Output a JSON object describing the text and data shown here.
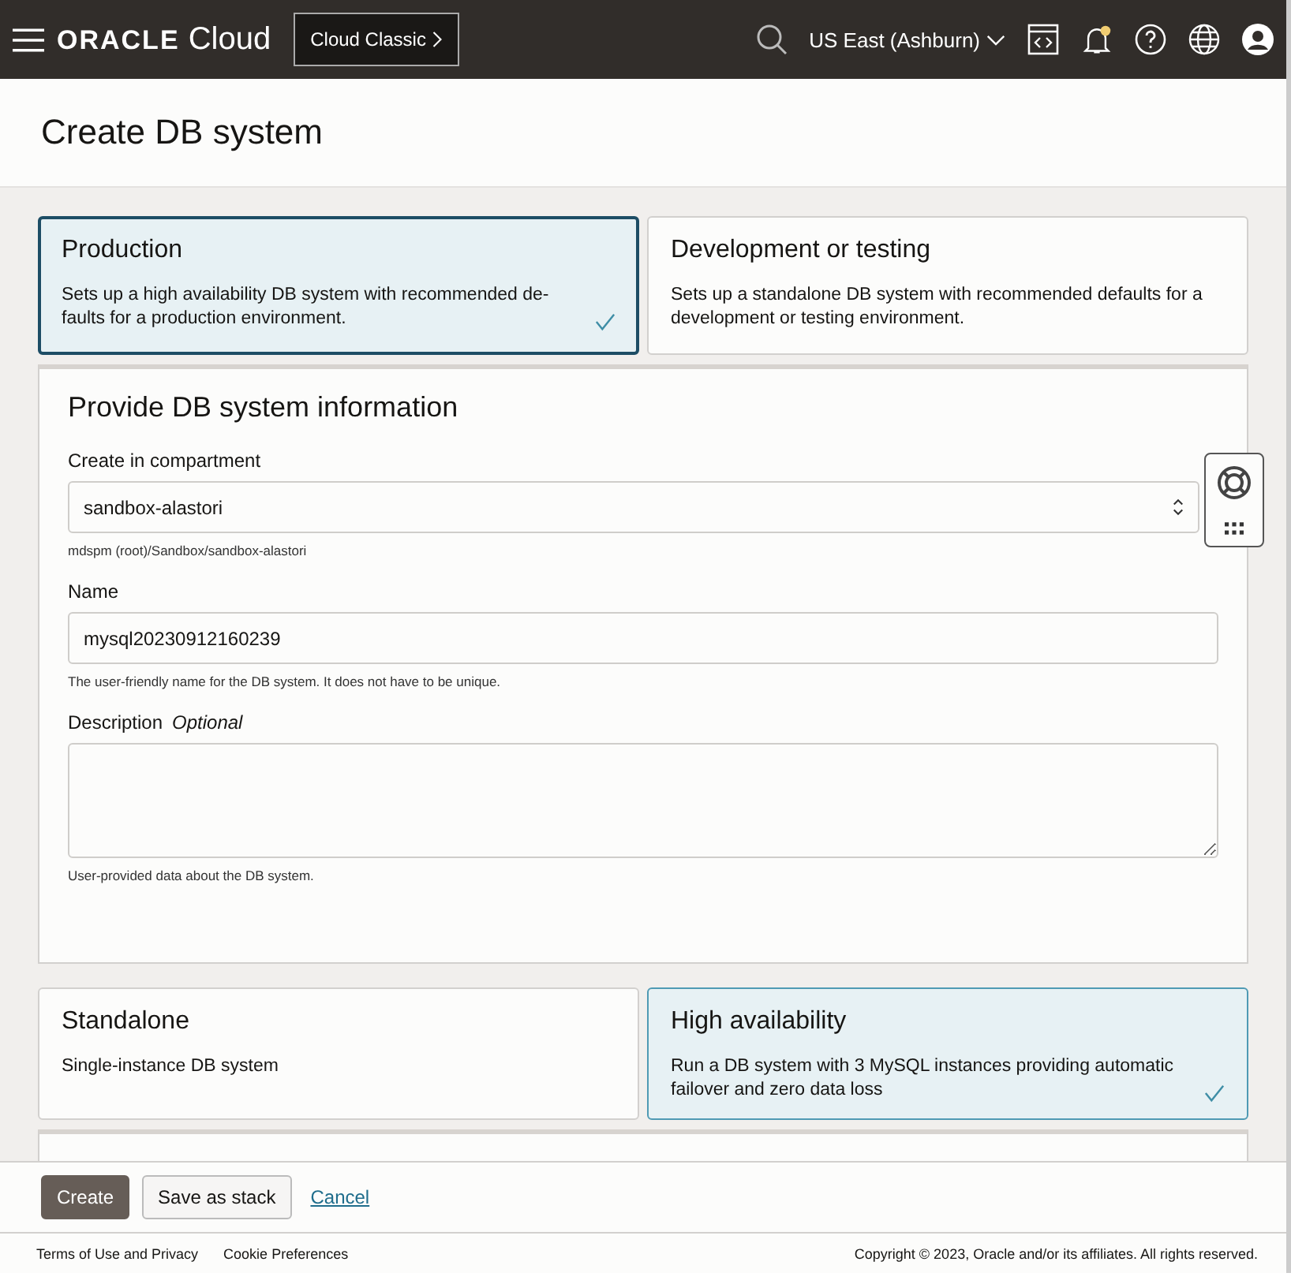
{
  "header": {
    "logo_brand": "ORACLE",
    "logo_product": "Cloud",
    "classic_button": "Cloud Classic",
    "region": "US East (Ashburn)",
    "notification_unread": true
  },
  "page_title": "Create DB system",
  "deployment_options": [
    {
      "title": "Production",
      "description": "Sets up a high availability DB system with recommended de-faults for a production environment.",
      "selected": true
    },
    {
      "title": "Development or testing",
      "description": "Sets up a standalone DB system with recommended defaults for a development or testing environment.",
      "selected": false
    }
  ],
  "info_section": {
    "title": "Provide DB system information",
    "fields": [
      {
        "kind": "select",
        "label": "Create in compartment",
        "value": "sandbox-alastori",
        "help": "mdspm (root)/Sandbox/sandbox-alastori"
      },
      {
        "kind": "text",
        "label": "Name",
        "value": "mysql20230912160239",
        "help": "The user-friendly name for the DB system. It does not have to be unique."
      },
      {
        "kind": "textarea",
        "label": "Description",
        "optional": "Optional",
        "help": "User-provided data about the DB system."
      }
    ]
  },
  "availability_options": [
    {
      "title": "Standalone",
      "description": "Single-instance DB system",
      "selected": false
    },
    {
      "title": "High availability",
      "description": "Run a DB system with 3 MySQL instances providing automatic failover and zero data loss",
      "selected": true
    }
  ],
  "actions": [
    {
      "kind": "primary",
      "label": "Create"
    },
    {
      "kind": "secondary",
      "label": "Save as stack"
    },
    {
      "kind": "link",
      "label": "Cancel"
    }
  ],
  "footer": {
    "links": [
      "Terms of Use and Privacy",
      "Cookie Preferences"
    ],
    "copyright": "Copyright © 2023, Oracle and/or its affiliates. All rights reserved."
  }
}
